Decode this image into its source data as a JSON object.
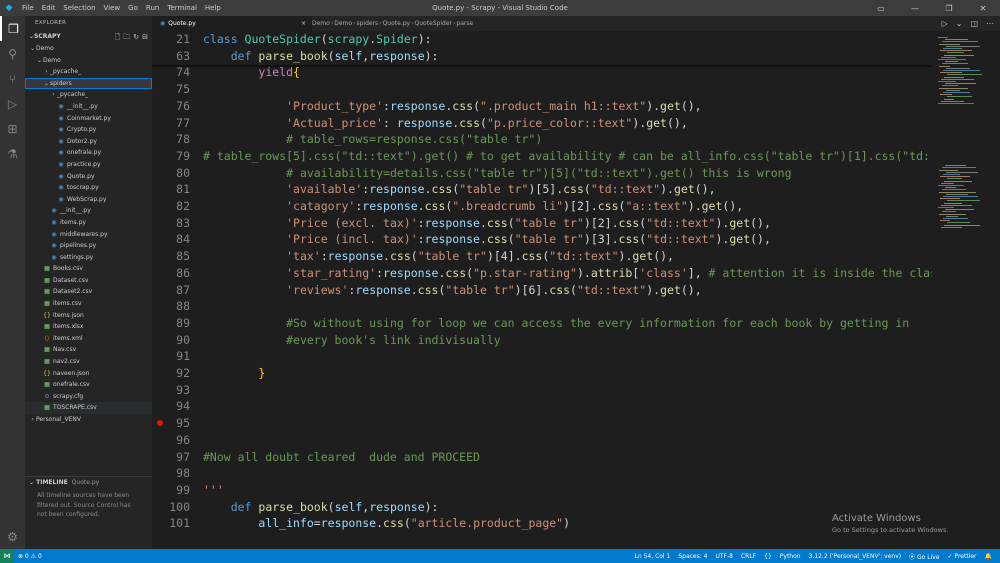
{
  "window": {
    "title": "Quote.py - Scrapy - Visual Studio Code",
    "menu": [
      "File",
      "Edit",
      "Selection",
      "View",
      "Go",
      "Run",
      "Terminal",
      "Help"
    ]
  },
  "sidebar": {
    "explorer_title": "EXPLORER",
    "workspace": "SCRAPY",
    "tree": [
      {
        "label": "Demo",
        "depth": 0,
        "type": "folder",
        "open": true
      },
      {
        "label": "Demo",
        "depth": 1,
        "type": "folder",
        "open": true
      },
      {
        "label": "_pycache_",
        "depth": 2,
        "type": "folder",
        "open": false
      },
      {
        "label": "spiders",
        "depth": 2,
        "type": "folder",
        "open": true,
        "selected": true
      },
      {
        "label": "_pycache_",
        "depth": 3,
        "type": "folder",
        "open": false
      },
      {
        "label": "__init__.py",
        "depth": 3,
        "type": "py"
      },
      {
        "label": "Coinmarket.py",
        "depth": 3,
        "type": "py"
      },
      {
        "label": "Crypto.py",
        "depth": 3,
        "type": "py"
      },
      {
        "label": "Dotor2.py",
        "depth": 3,
        "type": "py"
      },
      {
        "label": "onefrale.py",
        "depth": 3,
        "type": "py"
      },
      {
        "label": "practice.py",
        "depth": 3,
        "type": "py"
      },
      {
        "label": "Quote.py",
        "depth": 3,
        "type": "py"
      },
      {
        "label": "toscrap.py",
        "depth": 3,
        "type": "py"
      },
      {
        "label": "WebScrap.py",
        "depth": 3,
        "type": "py"
      },
      {
        "label": "__init__.py",
        "depth": 2,
        "type": "py"
      },
      {
        "label": "items.py",
        "depth": 2,
        "type": "py"
      },
      {
        "label": "middlewares.py",
        "depth": 2,
        "type": "py"
      },
      {
        "label": "pipelines.py",
        "depth": 2,
        "type": "py"
      },
      {
        "label": "settings.py",
        "depth": 2,
        "type": "py"
      },
      {
        "label": "Books.csv",
        "depth": 1,
        "type": "csv"
      },
      {
        "label": "Dataset.csv",
        "depth": 1,
        "type": "csv"
      },
      {
        "label": "Dataset2.csv",
        "depth": 1,
        "type": "csv"
      },
      {
        "label": "items.csv",
        "depth": 1,
        "type": "csv"
      },
      {
        "label": "items.json",
        "depth": 1,
        "type": "json"
      },
      {
        "label": "items.xlsx",
        "depth": 1,
        "type": "xlsx"
      },
      {
        "label": "items.xml",
        "depth": 1,
        "type": "xml"
      },
      {
        "label": "Nav.csv",
        "depth": 1,
        "type": "csv"
      },
      {
        "label": "nav2.csv",
        "depth": 1,
        "type": "csv"
      },
      {
        "label": "naveen.json",
        "depth": 1,
        "type": "json"
      },
      {
        "label": "onefrale.csv",
        "depth": 1,
        "type": "csv"
      },
      {
        "label": "scrapy.cfg",
        "depth": 1,
        "type": "cfg"
      },
      {
        "label": "TOSCRAPE.csv",
        "depth": 1,
        "type": "csv",
        "hover": true
      },
      {
        "label": "Personal_VENV",
        "depth": 0,
        "type": "folder",
        "open": false
      }
    ],
    "timeline": {
      "title": "TIMELINE",
      "file": "Quote.py",
      "message": "All timeline sources have been filtered out. Source Control has not been configured."
    }
  },
  "editor": {
    "tab_label": "Quote.py",
    "breadcrumb": [
      "Demo",
      "Demo",
      "spiders",
      "Quote.py",
      "QuoteSpider",
      "parse"
    ],
    "lines": [
      {
        "n": "21",
        "sticky": true,
        "tokens": [
          [
            "k",
            "class "
          ],
          [
            "c",
            "QuoteSpider"
          ],
          [
            "",
            "("
          ],
          [
            "c",
            "scrapy"
          ],
          [
            "",
            "."
          ],
          [
            "c",
            "Spider"
          ],
          [
            "",
            "):"
          ]
        ]
      },
      {
        "n": "63",
        "sticky": true,
        "tokens": [
          [
            "",
            "    "
          ],
          [
            "k",
            "def "
          ],
          [
            "f",
            "parse_book"
          ],
          [
            "",
            "("
          ],
          [
            "p",
            "self"
          ],
          [
            "",
            ","
          ],
          [
            "p",
            "response"
          ],
          [
            "",
            "):"
          ]
        ]
      },
      {
        "n": "74",
        "tokens": [
          [
            "",
            "        "
          ],
          [
            "kc",
            "yield"
          ],
          [
            "br",
            "{"
          ]
        ]
      },
      {
        "n": "75",
        "tokens": []
      },
      {
        "n": "76",
        "tokens": [
          [
            "",
            "            "
          ],
          [
            "s",
            "'Product_type'"
          ],
          [
            "",
            ":"
          ],
          [
            "p",
            "response"
          ],
          [
            "",
            "."
          ],
          [
            "f",
            "css"
          ],
          [
            "",
            "("
          ],
          [
            "s",
            "\".product_main h1::text\""
          ],
          [
            "",
            ")."
          ],
          [
            "f",
            "get"
          ],
          [
            "",
            "(),"
          ]
        ]
      },
      {
        "n": "77",
        "tokens": [
          [
            "",
            "            "
          ],
          [
            "s",
            "'Actual_price'"
          ],
          [
            "",
            ": "
          ],
          [
            "p",
            "response"
          ],
          [
            "",
            "."
          ],
          [
            "f",
            "css"
          ],
          [
            "",
            "("
          ],
          [
            "s",
            "\"p.price_color::text\""
          ],
          [
            "",
            ")."
          ],
          [
            "f",
            "get"
          ],
          [
            "",
            "(),"
          ]
        ]
      },
      {
        "n": "78",
        "tokens": [
          [
            "",
            "            "
          ],
          [
            "cm",
            "# table_rows=response.css(\"table tr\")"
          ]
        ]
      },
      {
        "n": "79",
        "tokens": [
          [
            "cm",
            "# table_rows[5].css(\"td::text\").get() # to get availability # can be all_info.css(\"table tr\")[1].css(\"td::"
          ]
        ]
      },
      {
        "n": "80",
        "tokens": [
          [
            "",
            "            "
          ],
          [
            "cm",
            "# availability=details.css(\"table tr\")[5](\"td::text\").get() this is wrong"
          ]
        ]
      },
      {
        "n": "81",
        "tokens": [
          [
            "",
            "            "
          ],
          [
            "s",
            "'available'"
          ],
          [
            "",
            ":"
          ],
          [
            "p",
            "response"
          ],
          [
            "",
            "."
          ],
          [
            "f",
            "css"
          ],
          [
            "",
            "("
          ],
          [
            "s",
            "\"table tr\""
          ],
          [
            "",
            ")[5]."
          ],
          [
            "f",
            "css"
          ],
          [
            "",
            "("
          ],
          [
            "s",
            "\"td::text\""
          ],
          [
            "",
            ")."
          ],
          [
            "f",
            "get"
          ],
          [
            "",
            "(),"
          ]
        ]
      },
      {
        "n": "82",
        "tokens": [
          [
            "",
            "            "
          ],
          [
            "s",
            "'catagory'"
          ],
          [
            "",
            ":"
          ],
          [
            "p",
            "response"
          ],
          [
            "",
            "."
          ],
          [
            "f",
            "css"
          ],
          [
            "",
            "("
          ],
          [
            "s",
            "\".breadcrumb li\""
          ],
          [
            "",
            ")[2]."
          ],
          [
            "f",
            "css"
          ],
          [
            "",
            "("
          ],
          [
            "s",
            "\"a::text\""
          ],
          [
            "",
            ")."
          ],
          [
            "f",
            "get"
          ],
          [
            "",
            "(),"
          ]
        ]
      },
      {
        "n": "83",
        "tokens": [
          [
            "",
            "            "
          ],
          [
            "s",
            "'Price (excl. tax)'"
          ],
          [
            "",
            ":"
          ],
          [
            "p",
            "response"
          ],
          [
            "",
            "."
          ],
          [
            "f",
            "css"
          ],
          [
            "",
            "("
          ],
          [
            "s",
            "\"table tr\""
          ],
          [
            "",
            ")[2]."
          ],
          [
            "f",
            "css"
          ],
          [
            "",
            "("
          ],
          [
            "s",
            "\"td::text\""
          ],
          [
            "",
            ")."
          ],
          [
            "f",
            "get"
          ],
          [
            "",
            "(),"
          ]
        ]
      },
      {
        "n": "84",
        "tokens": [
          [
            "",
            "            "
          ],
          [
            "s",
            "'Price (incl. tax)'"
          ],
          [
            "",
            ":"
          ],
          [
            "p",
            "response"
          ],
          [
            "",
            "."
          ],
          [
            "f",
            "css"
          ],
          [
            "",
            "("
          ],
          [
            "s",
            "\"table tr\""
          ],
          [
            "",
            ")[3]."
          ],
          [
            "f",
            "css"
          ],
          [
            "",
            "("
          ],
          [
            "s",
            "\"td::text\""
          ],
          [
            "",
            ")."
          ],
          [
            "f",
            "get"
          ],
          [
            "",
            "(),"
          ]
        ]
      },
      {
        "n": "85",
        "tokens": [
          [
            "",
            "            "
          ],
          [
            "s",
            "'tax'"
          ],
          [
            "",
            ":"
          ],
          [
            "p",
            "response"
          ],
          [
            "",
            "."
          ],
          [
            "f",
            "css"
          ],
          [
            "",
            "("
          ],
          [
            "s",
            "\"table tr\""
          ],
          [
            "",
            ")[4]."
          ],
          [
            "f",
            "css"
          ],
          [
            "",
            "("
          ],
          [
            "s",
            "\"td::text\""
          ],
          [
            "",
            ")."
          ],
          [
            "f",
            "get"
          ],
          [
            "",
            "(),"
          ]
        ]
      },
      {
        "n": "86",
        "tokens": [
          [
            "",
            "            "
          ],
          [
            "s",
            "'star_rating'"
          ],
          [
            "",
            ":"
          ],
          [
            "p",
            "response"
          ],
          [
            "",
            "."
          ],
          [
            "f",
            "css"
          ],
          [
            "",
            "("
          ],
          [
            "s",
            "\"p.star-rating\""
          ],
          [
            "",
            ")."
          ],
          [
            "f",
            "attrib"
          ],
          [
            "",
            "["
          ],
          [
            "s",
            "'class'"
          ],
          [
            "",
            "], "
          ],
          [
            "cm",
            "# attention it is inside the clas"
          ]
        ]
      },
      {
        "n": "87",
        "tokens": [
          [
            "",
            "            "
          ],
          [
            "s",
            "'reviews'"
          ],
          [
            "",
            ":"
          ],
          [
            "p",
            "response"
          ],
          [
            "",
            "."
          ],
          [
            "f",
            "css"
          ],
          [
            "",
            "("
          ],
          [
            "s",
            "\"table tr\""
          ],
          [
            "",
            ")[6]."
          ],
          [
            "f",
            "css"
          ],
          [
            "",
            "("
          ],
          [
            "s",
            "\"td::text\""
          ],
          [
            "",
            ")."
          ],
          [
            "f",
            "get"
          ],
          [
            "",
            "(),"
          ]
        ]
      },
      {
        "n": "88",
        "tokens": []
      },
      {
        "n": "89",
        "tokens": [
          [
            "",
            "            "
          ],
          [
            "cm",
            "#So without using for loop we can access the every information for each book by getting in"
          ]
        ]
      },
      {
        "n": "90",
        "tokens": [
          [
            "",
            "            "
          ],
          [
            "cm",
            "#every book's link indivisually"
          ]
        ]
      },
      {
        "n": "91",
        "tokens": []
      },
      {
        "n": "92",
        "tokens": [
          [
            "",
            "        "
          ],
          [
            "br",
            "}"
          ]
        ]
      },
      {
        "n": "93",
        "tokens": []
      },
      {
        "n": "94",
        "tokens": []
      },
      {
        "n": "95",
        "breakpoint": true,
        "tokens": []
      },
      {
        "n": "96",
        "tokens": []
      },
      {
        "n": "97",
        "tokens": [
          [
            "cm",
            "#Now all doubt cleared  dude and PROCEED"
          ]
        ]
      },
      {
        "n": "98",
        "tokens": []
      },
      {
        "n": "99",
        "tokens": [
          [
            "s",
            "'''"
          ]
        ]
      },
      {
        "n": "100",
        "tokens": [
          [
            "",
            "    "
          ],
          [
            "k",
            "def "
          ],
          [
            "f",
            "parse_book"
          ],
          [
            "",
            "("
          ],
          [
            "p",
            "self"
          ],
          [
            "",
            ","
          ],
          [
            "p",
            "response"
          ],
          [
            "",
            "):"
          ]
        ]
      },
      {
        "n": "101",
        "tokens": [
          [
            "",
            "        "
          ],
          [
            "p",
            "all_info"
          ],
          [
            "",
            "="
          ],
          [
            "p",
            "response"
          ],
          [
            "",
            "."
          ],
          [
            "f",
            "css"
          ],
          [
            "",
            "("
          ],
          [
            "s",
            "\"article.product_page\""
          ],
          [
            "",
            ")"
          ]
        ]
      }
    ]
  },
  "watermark": {
    "line1": "Activate Windows",
    "line2": "Go to Settings to activate Windows."
  },
  "statusbar": {
    "errors": "⊗ 0 ⚠ 0",
    "position": "Ln 54, Col 1",
    "spaces": "Spaces: 4",
    "encoding": "UTF-8",
    "eol": "CRLF",
    "language": "Python",
    "interpreter": "3.12.2 ('Personal_VENV': venv)",
    "golive": "Go Live",
    "prettier": "Prettier"
  }
}
